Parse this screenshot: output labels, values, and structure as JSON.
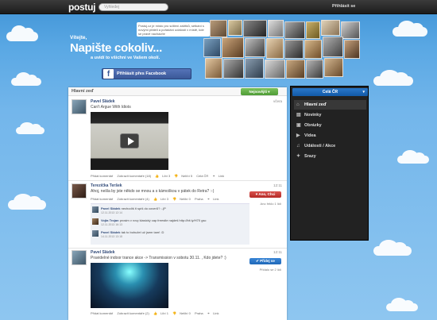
{
  "topbar": {
    "logo": "postuj",
    "search_placeholder": "Vyhledej",
    "login": "Přihlásit se"
  },
  "hero": {
    "description": "Postuj.cz je místo pro sdílení zážitků, setkání s novými přáteli a pořádání událostí v místě, kde se právě nacházíte",
    "welcome": "Vítejte,",
    "title": "Napište cokoliv...",
    "subtitle": "a uvidí to všichni ve Vašem okolí.",
    "fb_button": "Přihlásit přes Facebook"
  },
  "main": {
    "title": "Hlavní zeď",
    "filter_button": "Nejnovější"
  },
  "posts": [
    {
      "author": "Pavel Sládek",
      "text": "Can't Argue With Idiots",
      "time": "včera",
      "actions": [
        "Přidat komentář",
        "Zobrazit komentáře (18)",
        "Líbí 3",
        "Nelíbí 5",
        "Celá ČR",
        "Link"
      ]
    },
    {
      "author": "Terezička Teršek",
      "text": "Ahoj, nešla by jste někdo se mnou a s kámoškou v pátek do Retra? :-)",
      "time": "12:11",
      "actions": [
        "Přidat komentář",
        "Zobrazit komentáře (4)",
        "Líbí 3",
        "Nelíbí 0",
        "Praha",
        "Link"
      ],
      "vote_button": "Ano, Chci",
      "vote_note": "Ano řeklo 1 lidí",
      "comments": [
        {
          "author": "Pavel Sládek",
          "text": "nechodíš ti spíš do coverů? :-)P",
          "time": "12.11.2013 12:14"
        },
        {
          "author": "Vojta Trojan",
          "text": "prosim v rovy klasický cap freestle najdeš http://bit.ly/H70 gsc",
          "time": "12.11.2013 16:13"
        },
        {
          "author": "Pavel Sládek",
          "text": "tak to bohužel už jsem tam! :D",
          "time": "14.11.2013 13:18"
        }
      ]
    },
    {
      "author": "Pavel Sládek",
      "text": "Pravidelné indoor trance akce -> Transmission v sobotu 30.11. , Kdo jdete? :)",
      "time": "12:11",
      "actions": [
        "Přidat komentář",
        "Zobrazit komentáře (2)",
        "Líbí 1",
        "Nelíbí 0",
        "Praha",
        "Link"
      ],
      "vote_button": "Přidej se",
      "vote_note": "Přidalo se 2 lidí"
    }
  ],
  "sidebar": {
    "region": "Celá ČR",
    "items": [
      {
        "icon": "home-icon",
        "label": "Hlavní zeď"
      },
      {
        "icon": "news-icon",
        "label": "Novinky"
      },
      {
        "icon": "image-icon",
        "label": "Obrázky"
      },
      {
        "icon": "video-icon",
        "label": "Videa"
      },
      {
        "icon": "event-icon",
        "label": "Události / Akce"
      },
      {
        "icon": "meeting-icon",
        "label": "Srazy"
      }
    ]
  },
  "colors": {
    "accent_green": "#4f9c36",
    "accent_red": "#c0392b",
    "accent_blue": "#1f68b8",
    "facebook": "#3b5998"
  }
}
